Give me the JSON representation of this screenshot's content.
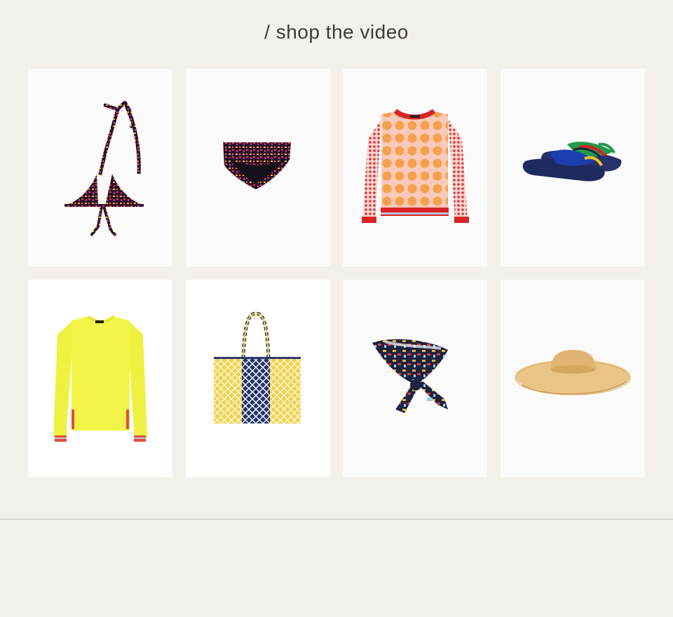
{
  "page": {
    "title": "/ shop the video"
  },
  "products": [
    {
      "name": "bikini-top",
      "icon": "bikini-top-icon"
    },
    {
      "name": "bikini-bottom",
      "icon": "bikini-bottom-icon"
    },
    {
      "name": "polka-dot-sweater",
      "icon": "sweater-icon"
    },
    {
      "name": "ruffle-slides",
      "icon": "slide-sandals-icon"
    },
    {
      "name": "yellow-sweater",
      "icon": "sweater-icon"
    },
    {
      "name": "woven-tote",
      "icon": "tote-bag-icon"
    },
    {
      "name": "silk-scarf",
      "icon": "scarf-icon"
    },
    {
      "name": "straw-hat",
      "icon": "sun-hat-icon"
    }
  ],
  "colors": {
    "background": "#f3efeb",
    "card": "#fafafa",
    "title_text": "#3f3b38"
  }
}
